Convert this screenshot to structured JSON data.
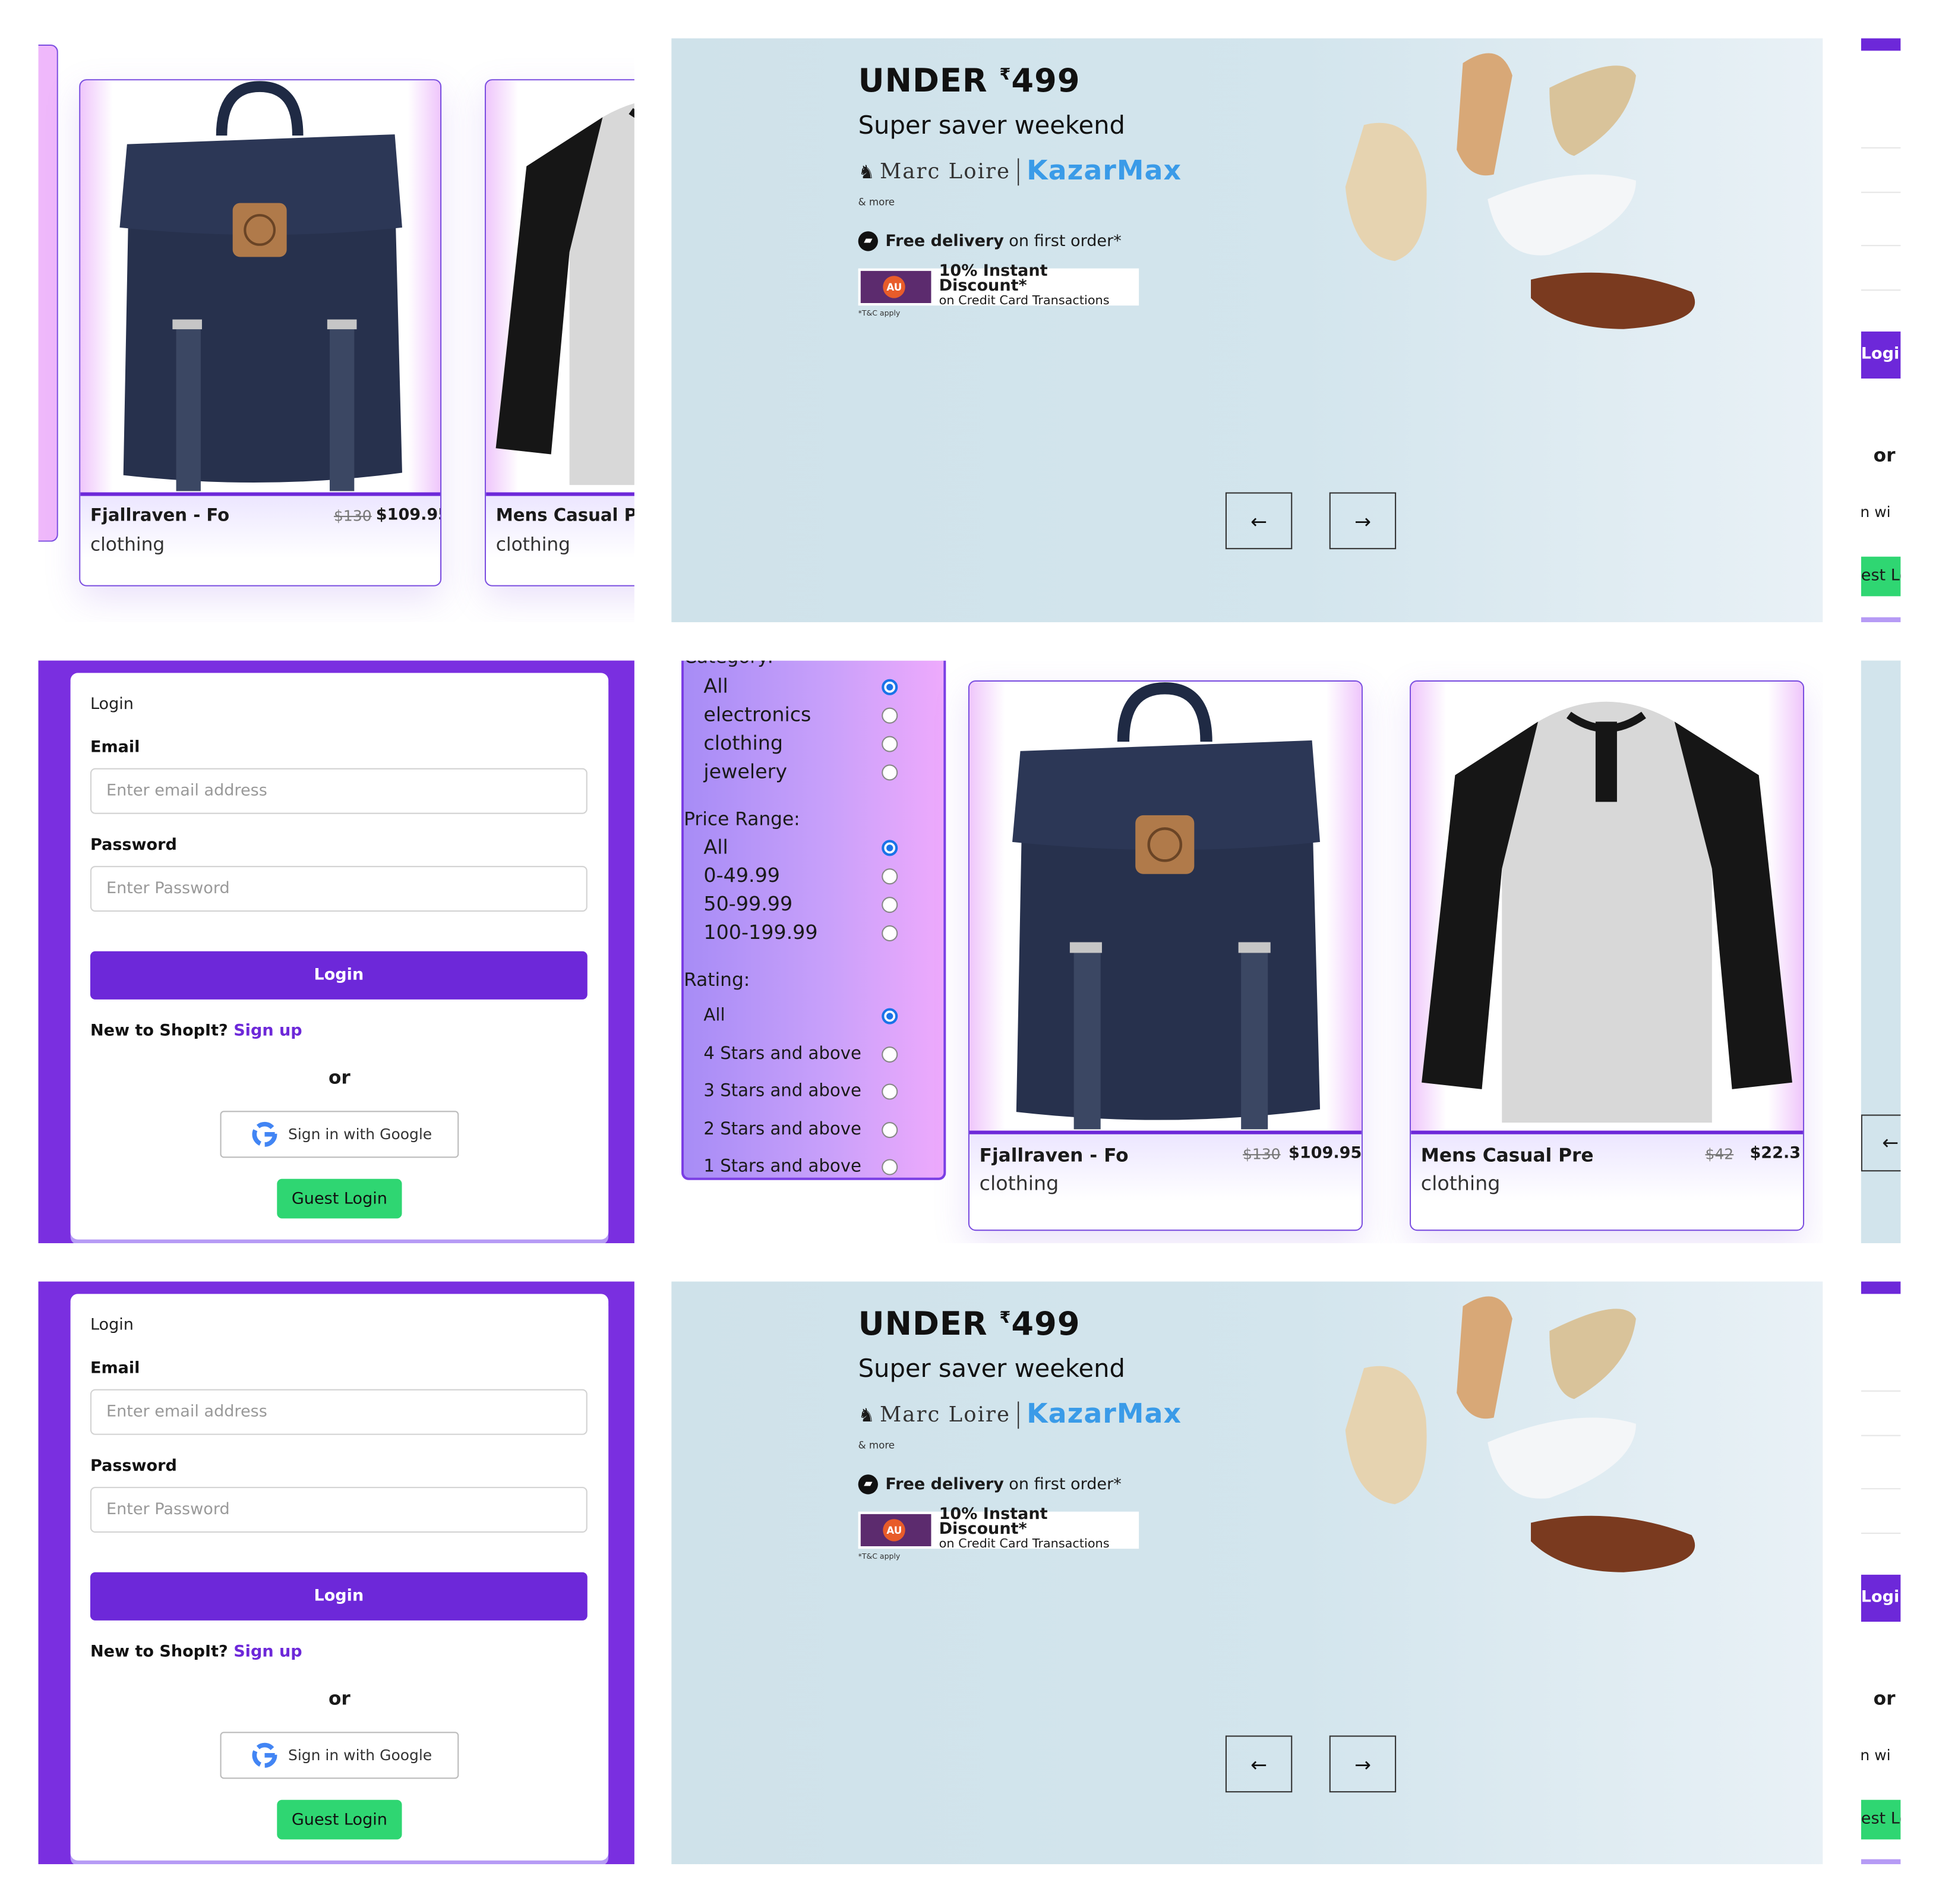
{
  "product_cards": {
    "card1": {
      "title": "Fjallraven - Fo",
      "category": "clothing",
      "old_price": "$130",
      "price": "$109.95"
    },
    "card2": {
      "title": "Mens Casual Pre",
      "category": "clothing",
      "old_price": "$42",
      "price": "$22.3"
    }
  },
  "banner": {
    "headline_prefix": "UNDER ",
    "currency": "₹",
    "headline_amount": "499",
    "subtitle": "Super saver weekend",
    "brand1": "Marc Loire",
    "brand2": "KazarMax",
    "more": "& more",
    "delivery_bold": "Free delivery",
    "delivery_rest": "on first order*",
    "discount_l1": "10% Instant Discount*",
    "discount_l2": "on Credit Card Transactions",
    "bank_logo": "AU",
    "tc": "*T&C apply",
    "prev_arrow": "←",
    "next_arrow": "→"
  },
  "login": {
    "title": "Login",
    "email_label": "Email",
    "email_placeholder": "Enter email address",
    "password_label": "Password",
    "password_placeholder": "Enter Password",
    "login_button": "Login",
    "new_text": "New to ShopIt?",
    "signup_link": "Sign up",
    "or": "or",
    "google_button": "Sign in with Google",
    "guest_button": "Guest Login"
  },
  "filters": {
    "category_heading": "Category:",
    "categories": [
      "All",
      "electronics",
      "clothing",
      "jewelery"
    ],
    "category_selected": "All",
    "price_heading": "Price Range:",
    "prices": [
      "All",
      "0-49.99",
      "50-99.99",
      "100-199.99"
    ],
    "price_selected": "All",
    "rating_heading": "Rating:",
    "ratings": [
      "All",
      "4 Stars and above",
      "3 Stars and above",
      "2 Stars and above",
      "1 Stars and above"
    ],
    "rating_selected": "All"
  },
  "edge_fragments": {
    "login_partial": "Logi",
    "or_partial": "or",
    "google_partial": "in wi",
    "guest_partial": "est Lo",
    "arrow_partial": "←"
  },
  "colors": {
    "accent_purple": "#6d28d9",
    "guest_green": "#2fd672",
    "link_blue": "#3a9be8"
  }
}
